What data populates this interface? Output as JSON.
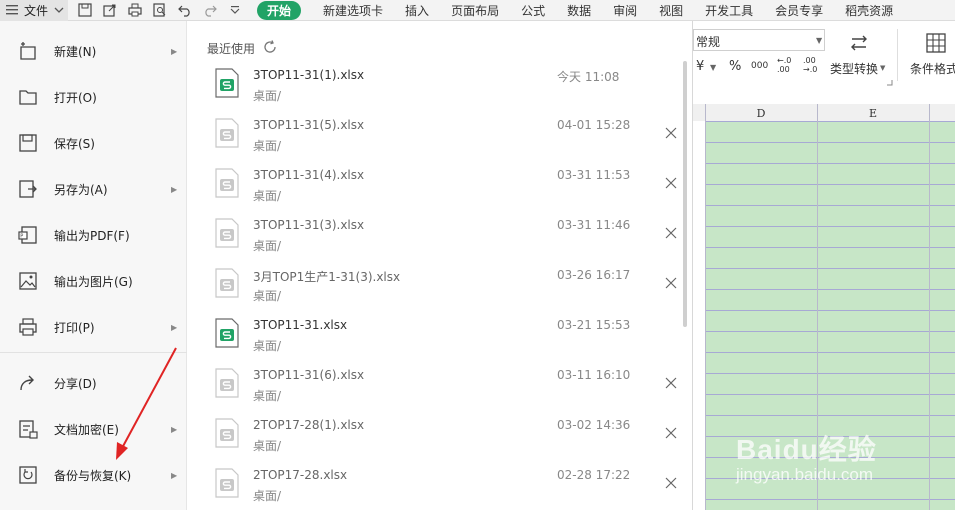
{
  "topbar": {
    "file_label": "文件",
    "tabs": [
      {
        "label": "开始",
        "active": true
      },
      {
        "label": "新建选项卡"
      },
      {
        "label": "插入"
      },
      {
        "label": "页面布局"
      },
      {
        "label": "公式"
      },
      {
        "label": "数据"
      },
      {
        "label": "审阅"
      },
      {
        "label": "视图"
      },
      {
        "label": "开发工具"
      },
      {
        "label": "会员专享"
      },
      {
        "label": "稻壳资源"
      }
    ],
    "icons": [
      "save-icon",
      "export-icon",
      "print-icon",
      "print-preview-icon",
      "undo-icon",
      "redo-icon",
      "customize-arrow-icon"
    ]
  },
  "left_menu": {
    "items": [
      {
        "label": "新建(N)",
        "icon": "new-file-icon",
        "submenu": true
      },
      {
        "label": "打开(O)",
        "icon": "open-folder-icon",
        "submenu": false
      },
      {
        "label": "保存(S)",
        "icon": "save-icon",
        "submenu": false
      },
      {
        "label": "另存为(A)",
        "icon": "save-as-icon",
        "submenu": true
      },
      {
        "label": "输出为PDF(F)",
        "icon": "pdf-icon",
        "submenu": false
      },
      {
        "label": "输出为图片(G)",
        "icon": "image-icon",
        "submenu": false
      },
      {
        "label": "打印(P)",
        "icon": "print-icon",
        "submenu": true
      },
      {
        "label": "分享(D)",
        "icon": "share-icon",
        "submenu": false
      },
      {
        "label": "文档加密(E)",
        "icon": "encrypt-icon",
        "submenu": true
      },
      {
        "label": "备份与恢复(K)",
        "icon": "backup-icon",
        "submenu": true
      }
    ]
  },
  "recent": {
    "title": "最近使用",
    "files": [
      {
        "name": "3TOP11-31(1).xlsx",
        "path": "桌面/",
        "date": "今天  11:08",
        "active": true,
        "closable": false
      },
      {
        "name": "3TOP11-31(5).xlsx",
        "path": "桌面/",
        "date": "04-01 15:28",
        "active": false,
        "closable": true
      },
      {
        "name": "3TOP11-31(4).xlsx",
        "path": "桌面/",
        "date": "03-31 11:53",
        "active": false,
        "closable": true
      },
      {
        "name": "3TOP11-31(3).xlsx",
        "path": "桌面/",
        "date": "03-31 11:46",
        "active": false,
        "closable": true
      },
      {
        "name": "3月TOP1生产1-31(3).xlsx",
        "path": "桌面/",
        "date": "03-26 16:17",
        "active": false,
        "closable": true
      },
      {
        "name": "3TOP11-31.xlsx",
        "path": "桌面/",
        "date": "03-21 15:53",
        "active": true,
        "closable": false
      },
      {
        "name": "3TOP11-31(6).xlsx",
        "path": "桌面/",
        "date": "03-11 16:10",
        "active": false,
        "closable": true
      },
      {
        "name": "2TOP17-28(1).xlsx",
        "path": "桌面/",
        "date": "03-02 14:36",
        "active": false,
        "closable": true
      },
      {
        "name": "2TOP17-28.xlsx",
        "path": "桌面/",
        "date": "02-28 17:22",
        "active": false,
        "closable": true
      }
    ]
  },
  "sheet": {
    "number_format": "常规",
    "format_symbols": [
      "¥",
      "%",
      "000",
      "←.0 .00",
      ".00 →.0"
    ],
    "type_convert_label": "类型转换",
    "cond_format_label": "条件格式",
    "columns": [
      "D",
      "E"
    ]
  },
  "colors": {
    "accent_green": "#21a366",
    "cell_fill": "#c7e6c7",
    "grid_line": "#a7a9d4",
    "arrow_red": "#e02424"
  },
  "watermark": {
    "brand": "Baidu经验",
    "url": "jingyan.baidu.com"
  }
}
